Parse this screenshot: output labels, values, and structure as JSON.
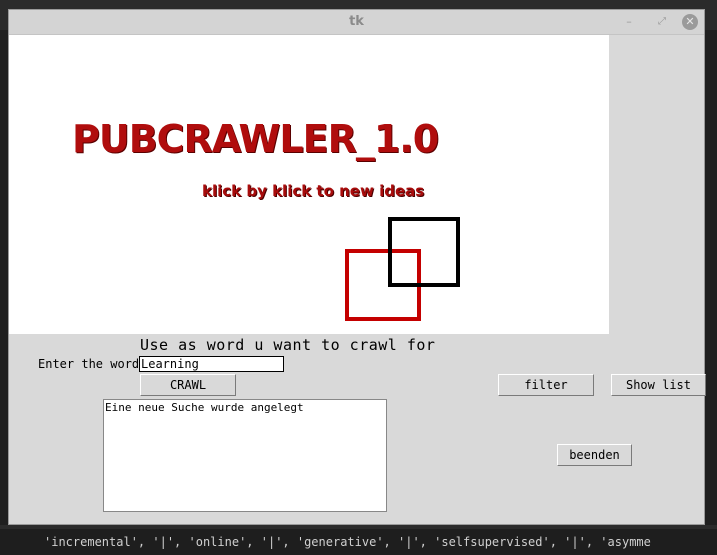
{
  "window": {
    "title": "tk",
    "controls": {
      "minimize": "–",
      "maximize": "⤢",
      "close": "✕"
    }
  },
  "canvas": {
    "logo_title": "PUBCRAWLER_1.0",
    "logo_subtitle": "klick by klick to new ideas",
    "colors": {
      "title": "#b00d0d",
      "red_square": "#c40000",
      "black_square": "#000000"
    }
  },
  "form": {
    "hint": "Use as word u want to crawl for",
    "word_label": "Enter the word",
    "word_value": "Learning",
    "crawl_button": "CRAWL",
    "filter_button": "filter",
    "show_list_button": "Show list",
    "quit_button": "beenden"
  },
  "output": {
    "text": "Eine neue Suche wurde angelegt"
  },
  "background": {
    "terminal_line": "'incremental', '|', 'online', '|', 'generative', '|', 'selfsupervised', '|', 'asymme"
  }
}
